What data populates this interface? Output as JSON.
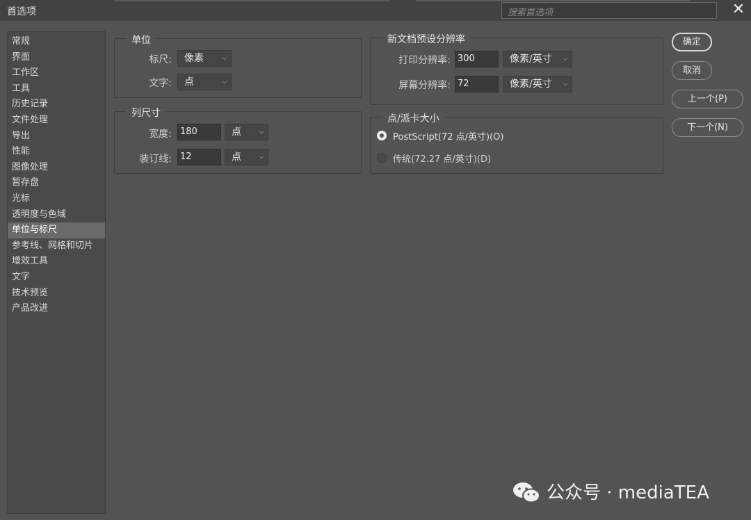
{
  "window": {
    "title": "首选项",
    "search_placeholder": "搜索首选项",
    "close_glyph": "✕"
  },
  "sidebar": {
    "items": [
      {
        "label": "常规"
      },
      {
        "label": "界面"
      },
      {
        "label": "工作区"
      },
      {
        "label": "工具"
      },
      {
        "label": "历史记录"
      },
      {
        "label": "文件处理"
      },
      {
        "label": "导出"
      },
      {
        "label": "性能"
      },
      {
        "label": "图像处理"
      },
      {
        "label": "暂存盘"
      },
      {
        "label": "光标"
      },
      {
        "label": "透明度与色域"
      },
      {
        "label": "单位与标尺",
        "active": true
      },
      {
        "label": "参考线、网格和切片"
      },
      {
        "label": "增效工具"
      },
      {
        "label": "文字"
      },
      {
        "label": "技术预览"
      },
      {
        "label": "产品改进"
      }
    ]
  },
  "units": {
    "title": "单位",
    "ruler_label": "标尺:",
    "ruler_value": "像素",
    "type_label": "文字:",
    "type_value": "点"
  },
  "column_size": {
    "title": "列尺寸",
    "width_label": "宽度:",
    "width_value": "180",
    "width_unit": "点",
    "gutter_label": "装订线:",
    "gutter_value": "12",
    "gutter_unit": "点"
  },
  "new_doc_resolution": {
    "title": "新文档预设分辨率",
    "print_label": "打印分辨率:",
    "print_value": "300",
    "print_unit": "像素/英寸",
    "screen_label": "屏幕分辨率:",
    "screen_value": "72",
    "screen_unit": "像素/英寸"
  },
  "point_pica": {
    "title": "点/派卡大小",
    "options": [
      {
        "label": "PostScript(72 点/英寸)(O)",
        "checked": true
      },
      {
        "label": "传统(72.27 点/英寸)(D)",
        "checked": false
      }
    ]
  },
  "buttons": {
    "ok": "确定",
    "cancel": "取消",
    "prev": "上一个(P)",
    "next": "下一个(N)"
  },
  "watermark": {
    "text": "公众号 · mediaTEA",
    "icon": "wechat-icon"
  },
  "icons": {
    "chevron": "chevron-down-icon"
  }
}
